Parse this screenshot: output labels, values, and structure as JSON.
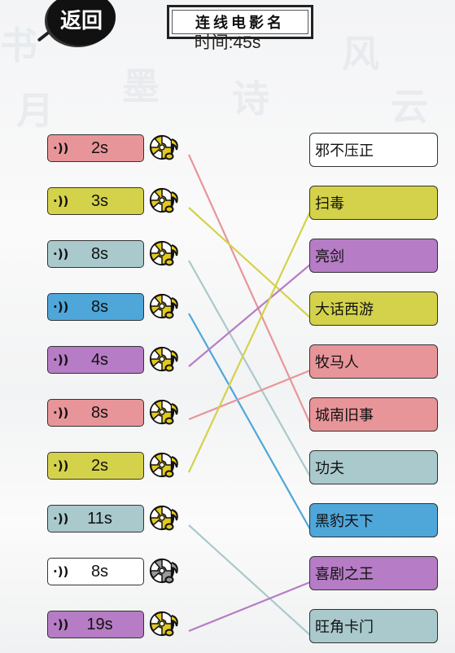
{
  "header": {
    "back_label": "返回",
    "title": "连线电影名",
    "timer": "时间:45s"
  },
  "colors": {
    "pink": "#e8959a",
    "yellow": "#d4d24a",
    "teal": "#a9c9cc",
    "blue": "#4fa6d9",
    "purple": "#b67cc5",
    "white": "#ffffff",
    "disc_active": "#e3c91c",
    "disc_inactive": "#9a9a9a"
  },
  "left_items": [
    {
      "duration": "2s",
      "color": "pink",
      "disc": "active",
      "match": 5
    },
    {
      "duration": "3s",
      "color": "yellow",
      "disc": "active",
      "match": 3
    },
    {
      "duration": "8s",
      "color": "teal",
      "disc": "active",
      "match": 6
    },
    {
      "duration": "8s",
      "color": "blue",
      "disc": "active",
      "match": 7
    },
    {
      "duration": "4s",
      "color": "purple",
      "disc": "active",
      "match": 2
    },
    {
      "duration": "8s",
      "color": "pink",
      "disc": "active",
      "match": 4
    },
    {
      "duration": "2s",
      "color": "yellow",
      "disc": "active",
      "match": 1
    },
    {
      "duration": "11s",
      "color": "teal",
      "disc": "active",
      "match": 9
    },
    {
      "duration": "8s",
      "color": "white",
      "disc": "inactive",
      "match": null
    },
    {
      "duration": "19s",
      "color": "purple",
      "disc": "active",
      "match": 8
    }
  ],
  "right_items": [
    {
      "title": "邪不压正",
      "color": "white"
    },
    {
      "title": "扫毒",
      "color": "yellow"
    },
    {
      "title": "亮剑",
      "color": "purple"
    },
    {
      "title": "大话西游",
      "color": "yellow"
    },
    {
      "title": "牧马人",
      "color": "pink"
    },
    {
      "title": "城南旧事",
      "color": "pink"
    },
    {
      "title": "功夫",
      "color": "teal"
    },
    {
      "title": "黑豹天下",
      "color": "blue"
    },
    {
      "title": "喜剧之王",
      "color": "purple"
    },
    {
      "title": "旺角卡门",
      "color": "teal"
    }
  ],
  "icons": {
    "sound": "·))",
    "disc": "music-disc-icon"
  }
}
